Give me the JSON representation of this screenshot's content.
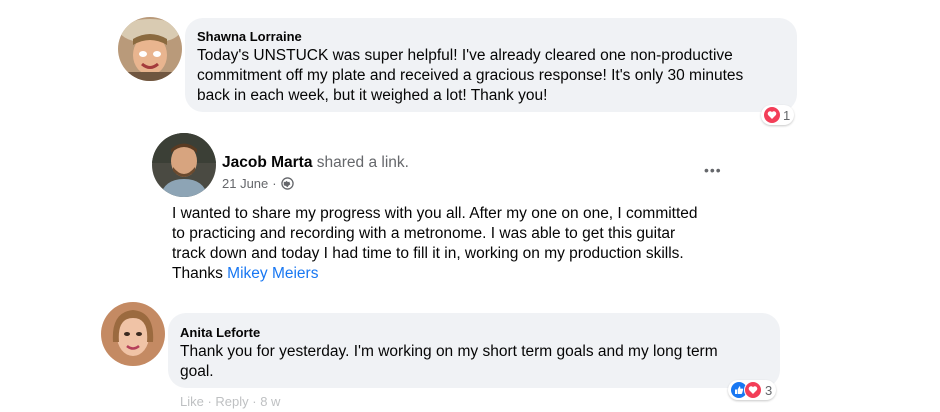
{
  "comments": [
    {
      "author": "Shawna Lorraine",
      "text_lines": [
        "Today's UNSTUCK was super helpful! I've already cleared one non-productive",
        "commitment off my plate and received a gracious response! It's only 30 minutes",
        "back in each week, but it weighed a lot! Thank you!"
      ],
      "reaction_count": "1",
      "reaction_icons": [
        "love-icon"
      ]
    },
    {
      "author": "Anita Leforte",
      "text_lines": [
        "Thank you for yesterday. I'm working on my short term goals and my long term",
        "goal."
      ],
      "reaction_count": "3",
      "reaction_icons": [
        "like-icon",
        "love-icon"
      ],
      "actions": "Like · Reply · 8 w"
    }
  ],
  "post": {
    "author": "Jacob Marta",
    "action": "shared a link.",
    "date": "21 June",
    "audience_icon": "globe-icon",
    "more_label": "•••",
    "text_lines": [
      "I wanted to share my progress with you all. After my one on one, I committed",
      "to practicing and recording with a metronome. I was able to get this guitar",
      "track down and today I had time to fill it in, working on my production skills."
    ],
    "thanks_prefix": "Thanks",
    "mention": "Mikey Meiers"
  },
  "colors": {
    "bubble": "#f0f2f5",
    "link": "#1877f2",
    "love": "#f33e58",
    "like": "#1877f2"
  }
}
